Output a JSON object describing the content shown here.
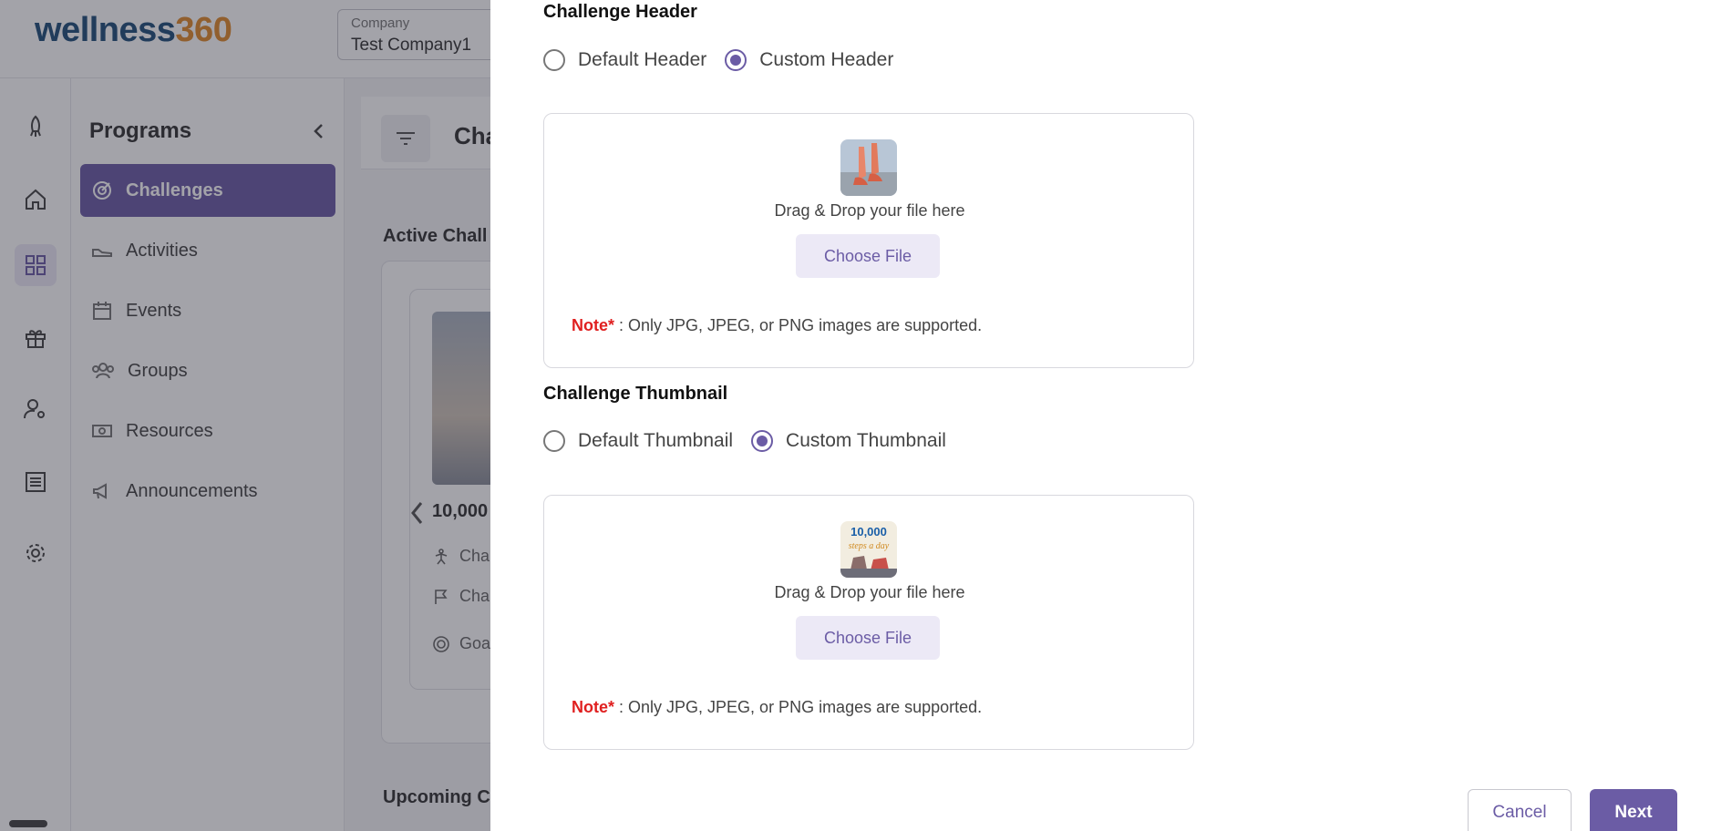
{
  "app": {
    "logo_word": "wellness",
    "logo_num": "360",
    "company": {
      "label": "Company",
      "value": "Test Company1"
    }
  },
  "rail": {
    "icons": [
      "rocket-icon",
      "home-icon",
      "grid-icon",
      "gift-icon",
      "user-settings-icon",
      "list-icon",
      "gear-icon"
    ]
  },
  "sidebar": {
    "title": "Programs",
    "items": [
      {
        "label": "Challenges",
        "icon": "target-icon",
        "active": true
      },
      {
        "label": "Activities",
        "icon": "shoe-icon"
      },
      {
        "label": "Events",
        "icon": "calendar-icon"
      },
      {
        "label": "Groups",
        "icon": "groups-icon"
      },
      {
        "label": "Resources",
        "icon": "money-icon"
      },
      {
        "label": "Announcements",
        "icon": "megaphone-icon"
      }
    ]
  },
  "main": {
    "title": "Cha",
    "active_section": "Active Chall",
    "upcoming_section": "Upcoming C",
    "card": {
      "title": "10,000",
      "row1": "Cha",
      "row2": "Cha",
      "row3": "Goa"
    }
  },
  "panel": {
    "header_section": {
      "label": "Challenge Header",
      "options": [
        "Default Header",
        "Custom Header"
      ],
      "selected": "Custom Header",
      "dz_text": "Drag & Drop your file here",
      "choose": "Choose File",
      "note_prefix": "Note*",
      "note_text": " : Only JPG, JPEG, or PNG images are supported."
    },
    "thumb_section": {
      "label": "Challenge Thumbnail",
      "options": [
        "Default Thumbnail",
        "Custom Thumbnail"
      ],
      "selected": "Custom Thumbnail",
      "dz_text": "Drag & Drop your file here",
      "choose": "Choose File",
      "note_prefix": "Note*",
      "note_text": " : Only JPG, JPEG, or PNG images are supported.",
      "image_caption_1": "10,000",
      "image_caption_2": "steps a day"
    },
    "cancel": "Cancel",
    "next": "Next"
  }
}
